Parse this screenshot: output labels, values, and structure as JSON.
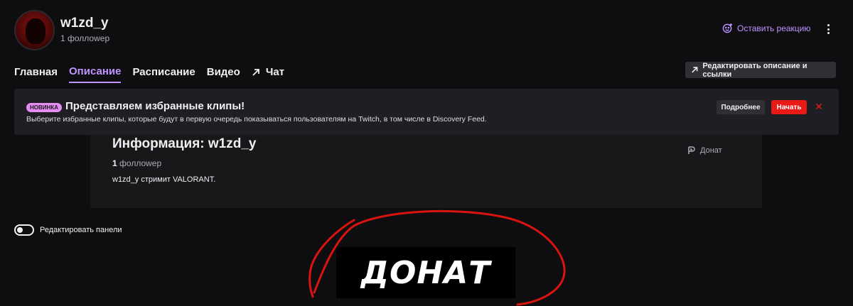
{
  "header": {
    "channel_name": "w1zd_y",
    "followers": "1 фоллоwер",
    "react_label": "Оставить реакцию"
  },
  "tabs": [
    {
      "label": "Главная"
    },
    {
      "label": "Описание",
      "active": true
    },
    {
      "label": "Расписание"
    },
    {
      "label": "Видео"
    },
    {
      "label": "Чат",
      "icon": "arrow-up-right-icon"
    }
  ],
  "edit_description_label": "Редактировать описание и ссылки",
  "banner": {
    "badge": "НОВИНКА",
    "title": "Представляем избранные клипы!",
    "text": "Выберите избранные клипы, которые будут в первую очередь показываться пользователям на Twitch, в том числе в Discovery Feed.",
    "more_label": "Подробнее",
    "start_label": "Начать",
    "close_icon": "close-icon"
  },
  "info": {
    "title": "Информация: w1zd_y",
    "followers_count": "1",
    "followers_label": "фоллоwер",
    "description": "w1zd_y стримит VALORANT.",
    "donate_link": "Донат"
  },
  "edit_panels_label": "Редактировать панели",
  "donate_panel_text": "ДОНАТ",
  "colors": {
    "accent": "#bf94ff",
    "background": "#0e0e10",
    "card": "#18181b",
    "danger": "#e91916",
    "badge": "#e78bf5",
    "scribble": "#d9140f"
  }
}
